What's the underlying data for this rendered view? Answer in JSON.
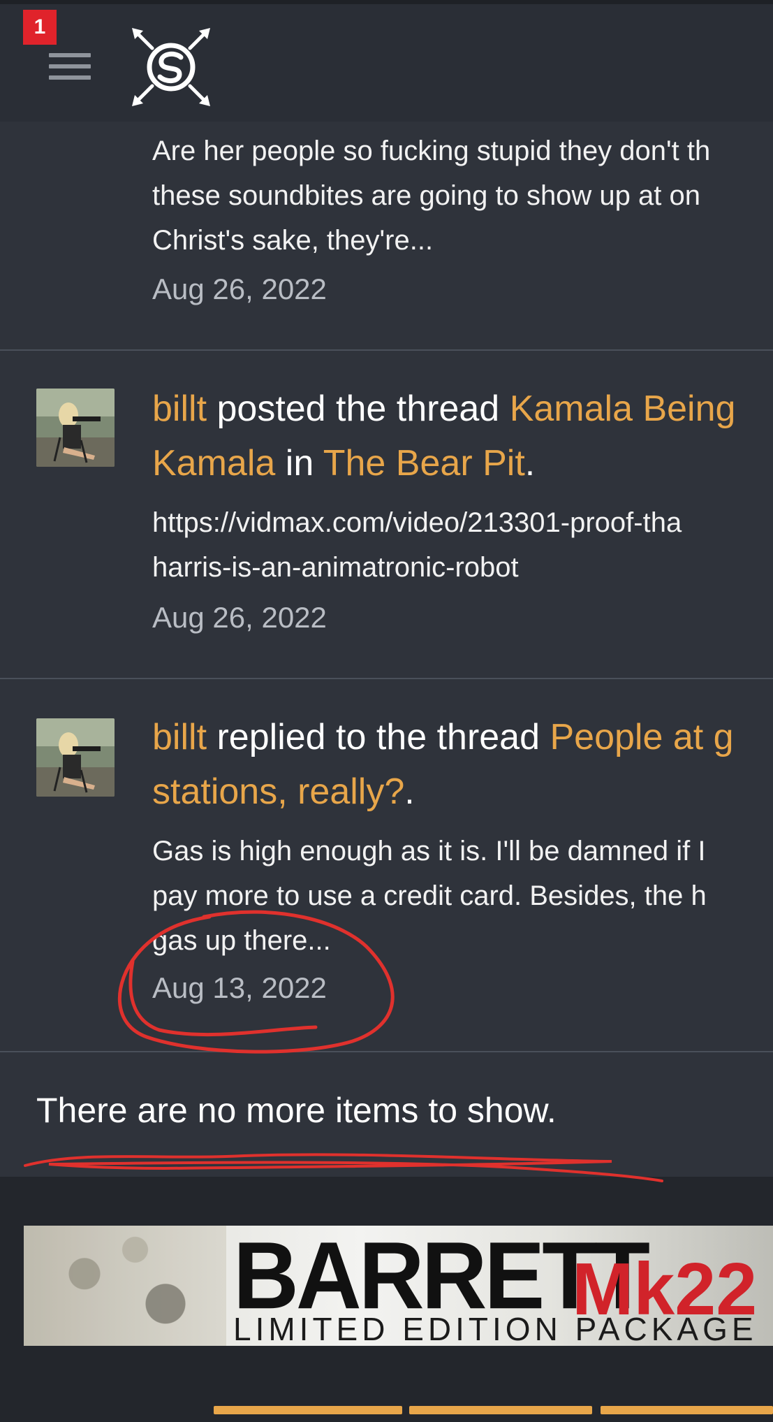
{
  "header": {
    "notification_count": "1",
    "menu_icon": "hamburger-menu-icon",
    "logo_icon": "site-logo-icon"
  },
  "feed": [
    {
      "type": "partial",
      "snippet_lines": [
        "Are her people so fucking stupid they don't th",
        "these soundbites are going to show up at on",
        "Christ's sake, they're..."
      ],
      "date": "Aug 26, 2022"
    },
    {
      "user": "billt",
      "action": " posted the thread ",
      "thread_title_line1": "Kamala Being",
      "thread_title_line2": "Kamala",
      "in_word": " in ",
      "forum": "The Bear Pit",
      "end_punct": ".",
      "snippet_lines": [
        "https://vidmax.com/video/213301-proof-tha",
        "harris-is-an-animatronic-robot"
      ],
      "date": "Aug 26, 2022"
    },
    {
      "user": "billt",
      "action": " replied to the thread ",
      "thread_title_line1": "People at g",
      "thread_title_line2": "stations, really?",
      "end_punct": ".",
      "snippet_lines": [
        "Gas is high enough as it is. I'll be damned if I",
        "pay more to use a credit card. Besides, the h",
        "gas up there..."
      ],
      "date": "Aug 13, 2022"
    }
  ],
  "end_message": "There are no more items to show.",
  "ad_banner": {
    "brand": "BARRETT",
    "model": "Mk22",
    "subtitle": "LIMITED EDITION PACKAGE"
  },
  "colors": {
    "background": "#2f333b",
    "link": "#e8a64a",
    "badge": "#e0232b",
    "annotation": "#e0312d"
  }
}
